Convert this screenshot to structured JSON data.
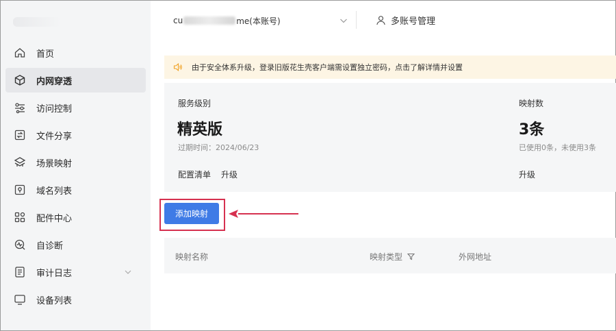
{
  "sidebar": {
    "items": [
      {
        "label": "首页",
        "icon": "home-icon"
      },
      {
        "label": "内网穿透",
        "icon": "cube-icon",
        "active": true
      },
      {
        "label": "访问控制",
        "icon": "sliders-icon"
      },
      {
        "label": "文件分享",
        "icon": "file-share-icon"
      },
      {
        "label": "场景映射",
        "icon": "scene-icon"
      },
      {
        "label": "域名列表",
        "icon": "domain-icon"
      },
      {
        "label": "配件中心",
        "icon": "grid-icon"
      },
      {
        "label": "自诊断",
        "icon": "diagnose-icon"
      },
      {
        "label": "审计日志",
        "icon": "log-icon",
        "expandable": true
      },
      {
        "label": "设备列表",
        "icon": "monitor-icon"
      }
    ]
  },
  "header": {
    "account_prefix": "cu",
    "account_suffix": "me(本账号)",
    "multi_account_label": "多账号管理"
  },
  "notice": {
    "text": "由于安全体系升级，登录旧版花生壳客户端需设置独立密码，点击了解详情并设置"
  },
  "service": {
    "level_label": "服务级别",
    "level_value": "精英版",
    "expiry": "过期时间：2024/06/23",
    "config_list_link": "配置清单",
    "upgrade_link": "升级",
    "mapping_label": "映射数",
    "mapping_value": "3条",
    "mapping_usage": "已使用0条，未使用3条",
    "mapping_upgrade_link": "升级"
  },
  "actions": {
    "add_mapping_label": "添加映射"
  },
  "table": {
    "columns": [
      "映射名称",
      "映射类型",
      "外网地址"
    ]
  },
  "colors": {
    "primary": "#3f7be6",
    "highlight": "#d6304f",
    "notice_bg": "#fdf5e4",
    "notice_icon": "#f0a020"
  }
}
